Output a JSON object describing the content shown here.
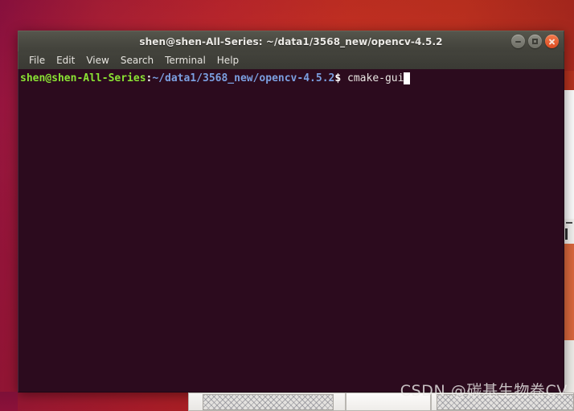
{
  "desktop": {
    "wallpaper_color": "#b4202a",
    "accent_color": "#dd4c22"
  },
  "terminal_window": {
    "title": "shen@shen-All-Series: ~/data1/3568_new/opencv-4.5.2",
    "background_color": "#2c0b1e",
    "titlebar_color": "#4b4b43",
    "controls": {
      "minimize_label": "Minimize",
      "maximize_label": "Maximize",
      "close_label": "Close"
    },
    "menubar": {
      "items": [
        {
          "label": "File"
        },
        {
          "label": "Edit"
        },
        {
          "label": "View"
        },
        {
          "label": "Search"
        },
        {
          "label": "Terminal"
        },
        {
          "label": "Help"
        }
      ]
    },
    "prompt": {
      "user_host": "shen@shen-All-Series",
      "separator": ":",
      "path": "~/data1/3568_new/opencv-4.5.2",
      "sigil": "$",
      "command": " cmake-gui",
      "user_host_color": "#8ae234",
      "path_color": "#7b9fe0",
      "command_color": "#e8e5e2",
      "cursor_color": "#ffffff"
    }
  },
  "background_windows": {
    "right_sliver_label": "partially-hidden-window-right",
    "bottom_windows_label": "partially-hidden-windows-bottom"
  },
  "watermark": {
    "text": "CSDN @碳基生物卷CV"
  }
}
